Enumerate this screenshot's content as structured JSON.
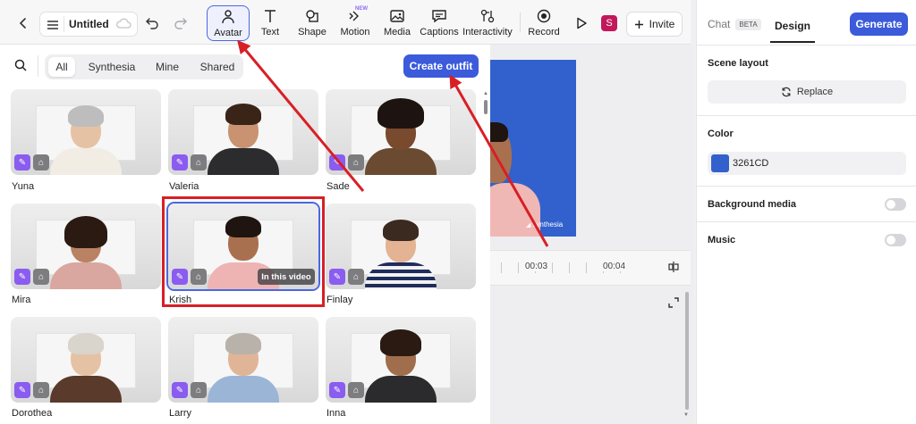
{
  "toolbar": {
    "title": "Untitled",
    "tools": [
      {
        "label": "Avatar",
        "icon": "avatar-icon"
      },
      {
        "label": "Text",
        "icon": "text-icon"
      },
      {
        "label": "Shape",
        "icon": "shape-icon"
      },
      {
        "label": "Motion",
        "icon": "motion-icon",
        "badge": "NEW"
      },
      {
        "label": "Media",
        "icon": "media-icon"
      },
      {
        "label": "Captions",
        "icon": "captions-icon"
      },
      {
        "label": "Interactivity",
        "icon": "interactivity-icon"
      },
      {
        "label": "Record",
        "icon": "record-icon"
      }
    ],
    "user_initial": "S",
    "invite_label": "Invite"
  },
  "avatar_panel": {
    "filters": [
      "All",
      "Synthesia",
      "Mine",
      "Shared"
    ],
    "active_filter": "All",
    "create_outfit_label": "Create outfit",
    "avatars": [
      {
        "name": "Yuna"
      },
      {
        "name": "Valeria"
      },
      {
        "name": "Sade"
      },
      {
        "name": "Mira"
      },
      {
        "name": "Krish",
        "status": "In this video"
      },
      {
        "name": "Finlay"
      },
      {
        "name": "Dorothea"
      },
      {
        "name": "Larry"
      },
      {
        "name": "Inna"
      }
    ]
  },
  "preview": {
    "watermark": "synthesia",
    "background_color": "#3261CD",
    "timeline": [
      "00:03",
      "00:04"
    ]
  },
  "right_panel": {
    "tabs": {
      "chat": "Chat",
      "chat_badge": "BETA",
      "design": "Design"
    },
    "generate_label": "Generate",
    "scene_layout": {
      "title": "Scene layout",
      "replace_label": "Replace"
    },
    "color": {
      "title": "Color",
      "value": "3261CD"
    },
    "background_media": {
      "label": "Background media",
      "enabled": false
    },
    "music": {
      "label": "Music",
      "enabled": false
    }
  },
  "colors": {
    "accent": "#3B5BDB",
    "highlight": "#d81f26",
    "badge_purple": "#8a5cf0",
    "user_avatar": "#c2185b"
  }
}
